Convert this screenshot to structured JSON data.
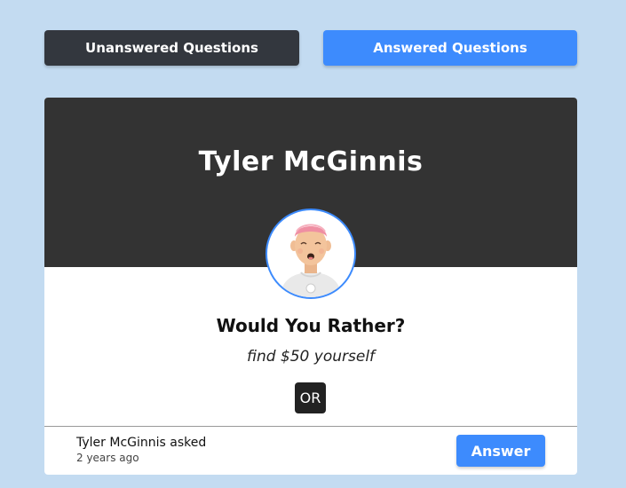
{
  "tabs": {
    "unanswered_label": "Unanswered Questions",
    "answered_label": "Answered Questions"
  },
  "question": {
    "author": "Tyler McGinnis",
    "title": "Would You Rather?",
    "option_one": "find $50 yourself",
    "separator": "OR",
    "asked_by": "Tyler McGinnis asked",
    "time": "2 years ago",
    "answer_label": "Answer",
    "avatar_icon": "avatar-icon"
  },
  "colors": {
    "background": "#c3dbf1",
    "dark_button": "#33373e",
    "accent": "#3d8bfd",
    "card_header": "#333333"
  }
}
